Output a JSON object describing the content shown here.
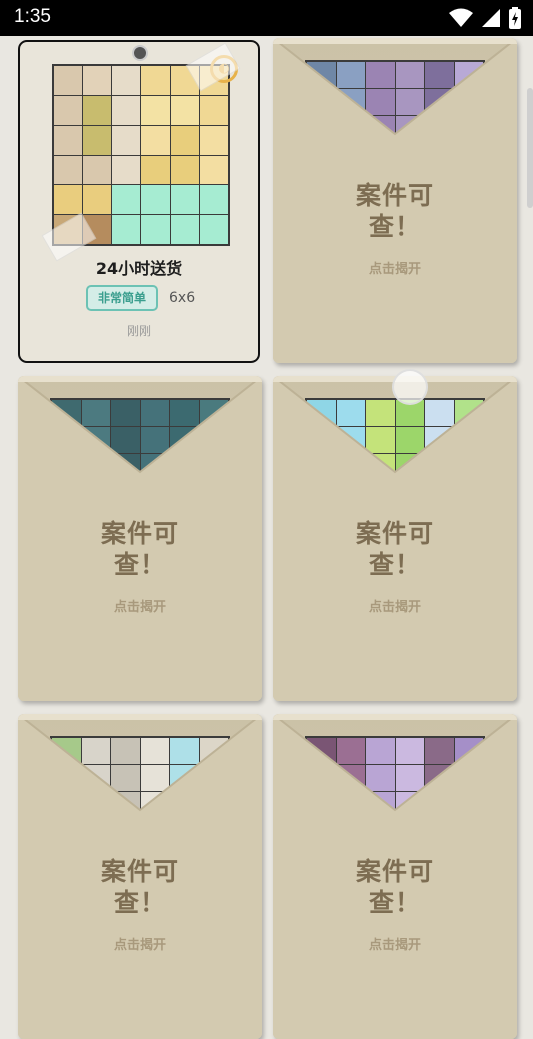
{
  "status": {
    "time": "1:35"
  },
  "solved_case": {
    "name": "24小时送货",
    "difficulty": "非常简单",
    "size": "6x6",
    "when": "刚刚"
  },
  "locked_cases": [
    {
      "title_line1": "案件可",
      "title_line2": "查！",
      "hint": "点击揭开",
      "preview": [
        "#6f87a6",
        "#8aa0c2",
        "#9b84b3",
        "#a896c0",
        "#7e6f9c",
        "#b8a9d6"
      ]
    },
    {
      "title_line1": "案件可",
      "title_line2": "查！",
      "hint": "点击揭开",
      "preview": [
        "#3f6a6f",
        "#4c7a80",
        "#3a6066",
        "#45727a",
        "#3c6a70",
        "#4a7a7e"
      ]
    },
    {
      "title_line1": "案件可",
      "title_line2": "查！",
      "hint": "点击揭开",
      "preview": [
        "#8fd6e6",
        "#9ddced",
        "#c4e37a",
        "#9cd66a",
        "#cbdff0",
        "#b1e28a"
      ]
    },
    {
      "title_line1": "案件可",
      "title_line2": "查！",
      "hint": "点击揭开",
      "preview": [
        "#a6c98a",
        "#d8d4ca",
        "#c7c2b6",
        "#e6e2d8",
        "#aee0e8",
        "#dcd6c8"
      ]
    },
    {
      "title_line1": "案件可",
      "title_line2": "查！",
      "hint": "点击揭开",
      "preview": [
        "#7a5574",
        "#9b6f93",
        "#b9a5d4",
        "#cbb9e0",
        "#8a6a88",
        "#a58fc8"
      ]
    }
  ]
}
